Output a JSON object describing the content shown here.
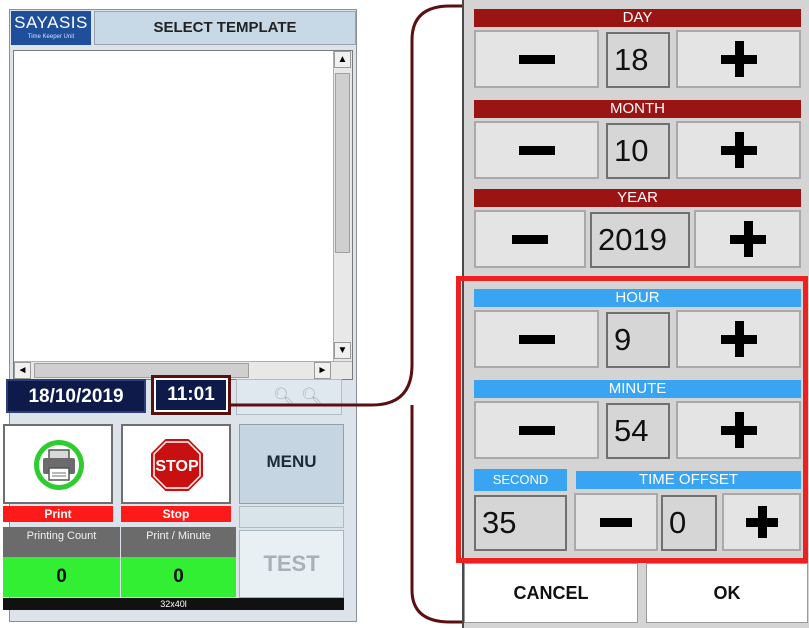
{
  "left_screen": {
    "logo": {
      "brand": "SAYASIS",
      "tagline": "Time Keeper Unit"
    },
    "header_title": "SELECT TEMPLATE",
    "scroll_glyphs": {
      "up": "▲",
      "down": "▼",
      "left": "◄",
      "right": "►"
    },
    "date": "18/10/2019",
    "time": "11:01",
    "zoom_icons": [
      "zoom-in-icon",
      "zoom-out-icon"
    ],
    "print_label": "Print",
    "stop_label": "Stop",
    "stop_sign_text": "STOP",
    "menu_label": "MENU",
    "test_label": "TEST",
    "printing_count_label": "Printing Count",
    "printing_count_value": "0",
    "print_per_minute_label": "Print / Minute",
    "print_per_minute_value": "0",
    "status_text": "32x40l"
  },
  "right_panel": {
    "day": {
      "label": "DAY",
      "value": "18"
    },
    "month": {
      "label": "MONTH",
      "value": "10"
    },
    "year": {
      "label": "YEAR",
      "value": "2019"
    },
    "hour": {
      "label": "HOUR",
      "value": "9"
    },
    "minute": {
      "label": "MINUTE",
      "value": "54"
    },
    "second": {
      "label": "SECOND",
      "value": "35"
    },
    "time_offset": {
      "label": "TIME OFFSET",
      "value": "0"
    },
    "cancel_label": "CANCEL",
    "ok_label": "OK"
  },
  "colors": {
    "header_red": "#9a1414",
    "header_blue": "#39a4f2",
    "highlight_red": "#ee2020",
    "connector_maroon": "#5a0f10",
    "print_green": "#33ef33",
    "stop_red": "#ff1a1a"
  }
}
